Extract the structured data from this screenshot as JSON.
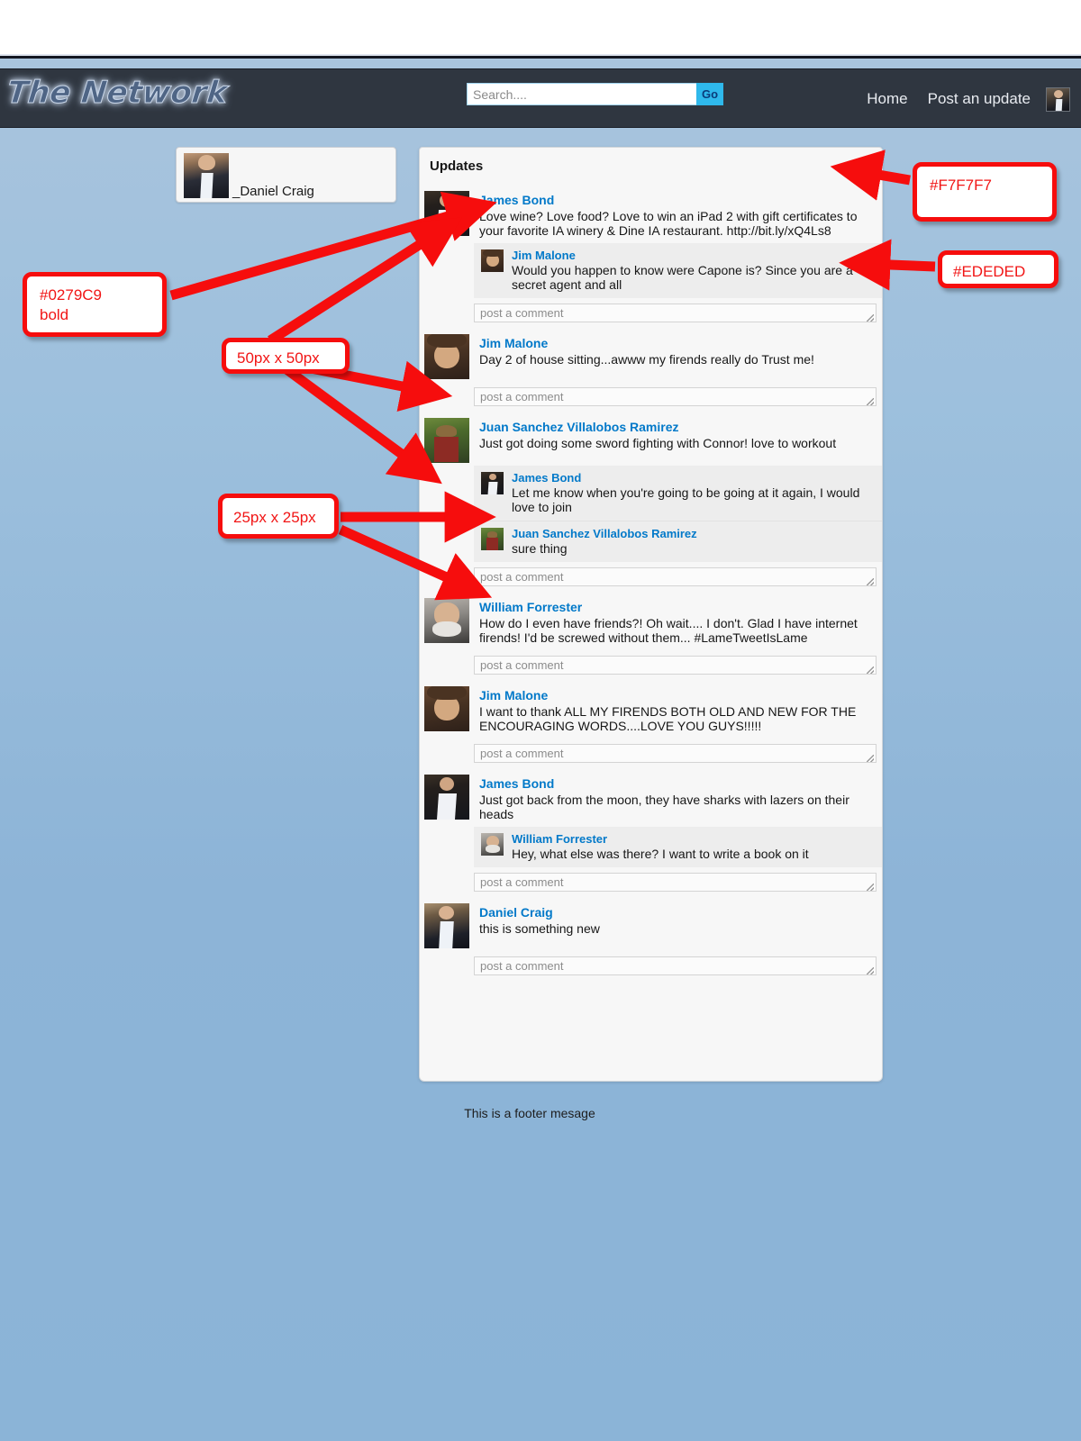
{
  "header": {
    "logo": "The Network",
    "search": {
      "placeholder": "Search....",
      "value": ""
    },
    "go_label": "Go",
    "nav": [
      {
        "label": "Home",
        "name": "nav-home"
      },
      {
        "label": "Post an update",
        "name": "nav-post-update"
      }
    ],
    "avatar_name": "header-user-avatar"
  },
  "sidebar": {
    "user_name": "_Daniel Craig"
  },
  "updates": {
    "title": "Updates",
    "comment_placeholder": "post a comment",
    "posts": [
      {
        "author": "James Bond",
        "avatar": "av-bond",
        "text": "Love wine? Love food? Love to win an iPad 2 with gift certificates to your favorite IA winery & Dine IA restaurant. http://bit.ly/xQ4Ls8",
        "comments": [
          {
            "author": "Jim Malone",
            "avatar": "av-malone",
            "text": "Would you happen to know were Capone is? Since you are a secret agent and all"
          }
        ]
      },
      {
        "author": "Jim Malone",
        "avatar": "av-malone",
        "text": "Day 2 of house sitting...awww my firends really do Trust me!",
        "comments": []
      },
      {
        "author": "Juan  Sanchez Villalobos Ramirez",
        "avatar": "av-juan",
        "text": "Just got doing some sword fighting with Connor! love to workout",
        "comments": [
          {
            "author": "James Bond",
            "avatar": "av-bond",
            "text": "Let me know when you're going to be going at it again, I would love to join"
          },
          {
            "author": "Juan  Sanchez Villalobos Ramirez",
            "avatar": "av-juan",
            "text": "sure thing"
          }
        ]
      },
      {
        "author": "William Forrester",
        "avatar": "av-forrester",
        "text": "How do I even have friends?! Oh wait.... I don't. Glad I have internet firends! I'd be screwed without them... #LameTweetIsLame",
        "comments": []
      },
      {
        "author": "Jim Malone",
        "avatar": "av-malone",
        "text": "I want to thank ALL MY FIRENDS BOTH OLD AND NEW FOR THE ENCOURAGING WORDS....LOVE YOU GUYS!!!!!",
        "comments": []
      },
      {
        "author": "James Bond",
        "avatar": "av-bond",
        "text": "Just got back from the moon, they have sharks with lazers on their heads",
        "comments": [
          {
            "author": "William Forrester",
            "avatar": "av-forrester",
            "text": "Hey, what else was there? I want to write a book on it"
          }
        ]
      },
      {
        "author": "Daniel Craig",
        "avatar": "av-daniel",
        "text": "this is something new",
        "comments": []
      }
    ]
  },
  "footer": {
    "text": "This is a footer mesage"
  },
  "annotations": {
    "panel_bg": "#F7F7F7",
    "comment_bg": "#EDEDED",
    "author_color": "#0279C9",
    "author_weight": "bold",
    "avatar_large": "50px  x 50px",
    "avatar_small": "25px x 25px",
    "marker_color": "#f60d0d"
  }
}
